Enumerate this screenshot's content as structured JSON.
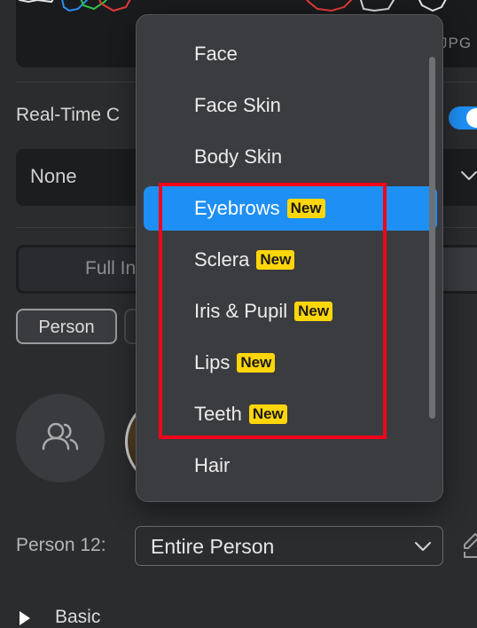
{
  "histogram": {
    "format_label": "JPG"
  },
  "realtime": {
    "label": "Real-Time C",
    "toggle_on": true
  },
  "preset_select": {
    "value": "None"
  },
  "mode_segment": {
    "option1": "Full In"
  },
  "chips": {
    "person": "Person"
  },
  "person_row": {
    "label": "Person 12:",
    "value": "Entire Person"
  },
  "section": {
    "basic": "Basic"
  },
  "menu": {
    "items": [
      {
        "label": "Face",
        "badge": ""
      },
      {
        "label": "Face Skin",
        "badge": ""
      },
      {
        "label": "Body Skin",
        "badge": ""
      },
      {
        "label": "Eyebrows",
        "badge": "New",
        "selected": true
      },
      {
        "label": "Sclera",
        "badge": "New"
      },
      {
        "label": "Iris & Pupil",
        "badge": "New"
      },
      {
        "label": "Lips",
        "badge": "New"
      },
      {
        "label": "Teeth",
        "badge": "New"
      },
      {
        "label": "Hair",
        "badge": ""
      }
    ]
  },
  "colors": {
    "accent": "#1e8ff5",
    "badge": "#ffd60a",
    "highlight": "#f2041b",
    "menu_bg": "#3b3c3f"
  }
}
